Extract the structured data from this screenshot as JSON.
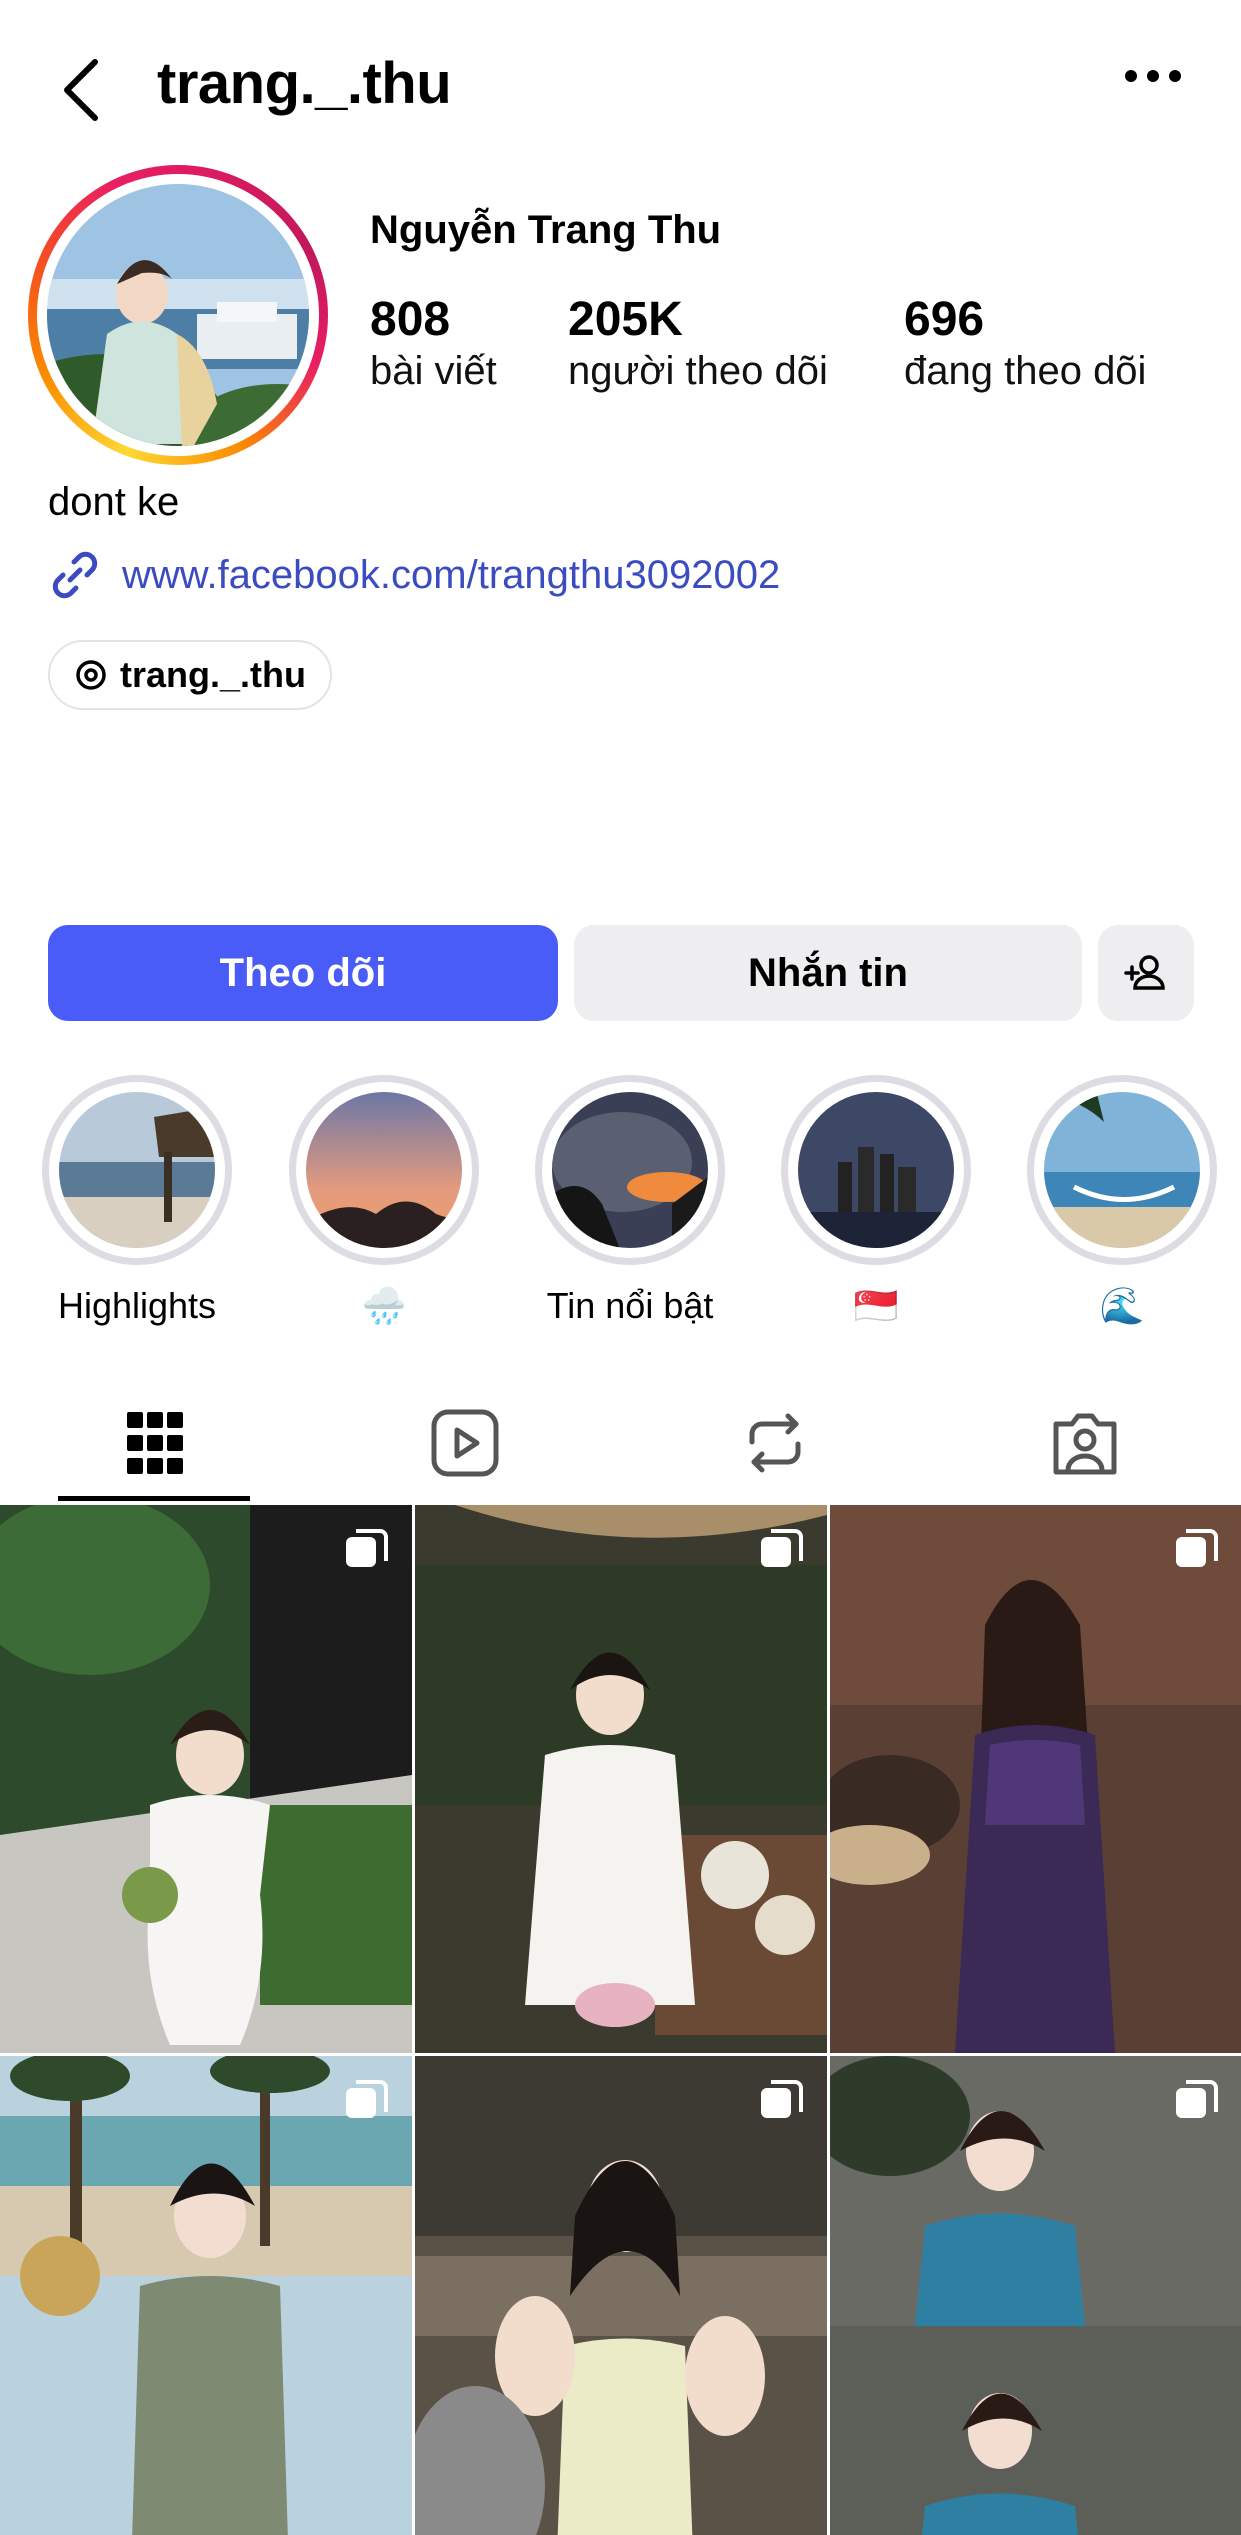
{
  "header": {
    "username": "trang._.thu"
  },
  "profile": {
    "full_name": "Nguyễn Trang Thu",
    "stats": [
      {
        "value": "808",
        "label": "bài viết"
      },
      {
        "value": "205K",
        "label": "người theo dõi"
      },
      {
        "value": "696",
        "label": "đang theo dõi"
      }
    ],
    "bio": "dont ke",
    "link": "www.facebook.com/trangthu3092002",
    "threads_handle": "trang._.thu"
  },
  "actions": {
    "follow_label": "Theo dõi",
    "message_label": "Nhắn tin"
  },
  "highlights": [
    {
      "label": "Highlights"
    },
    {
      "label": "🌧️"
    },
    {
      "label": "Tin nổi bật"
    },
    {
      "label": "🇸🇬"
    },
    {
      "label": "🌊"
    }
  ],
  "tabs": [
    "grid-icon",
    "reels-icon",
    "reposts-icon",
    "tagged-icon"
  ],
  "colors": {
    "accent": "#4a5cf7",
    "link": "#3b4cc0",
    "secondary_button": "#eeeef1"
  }
}
